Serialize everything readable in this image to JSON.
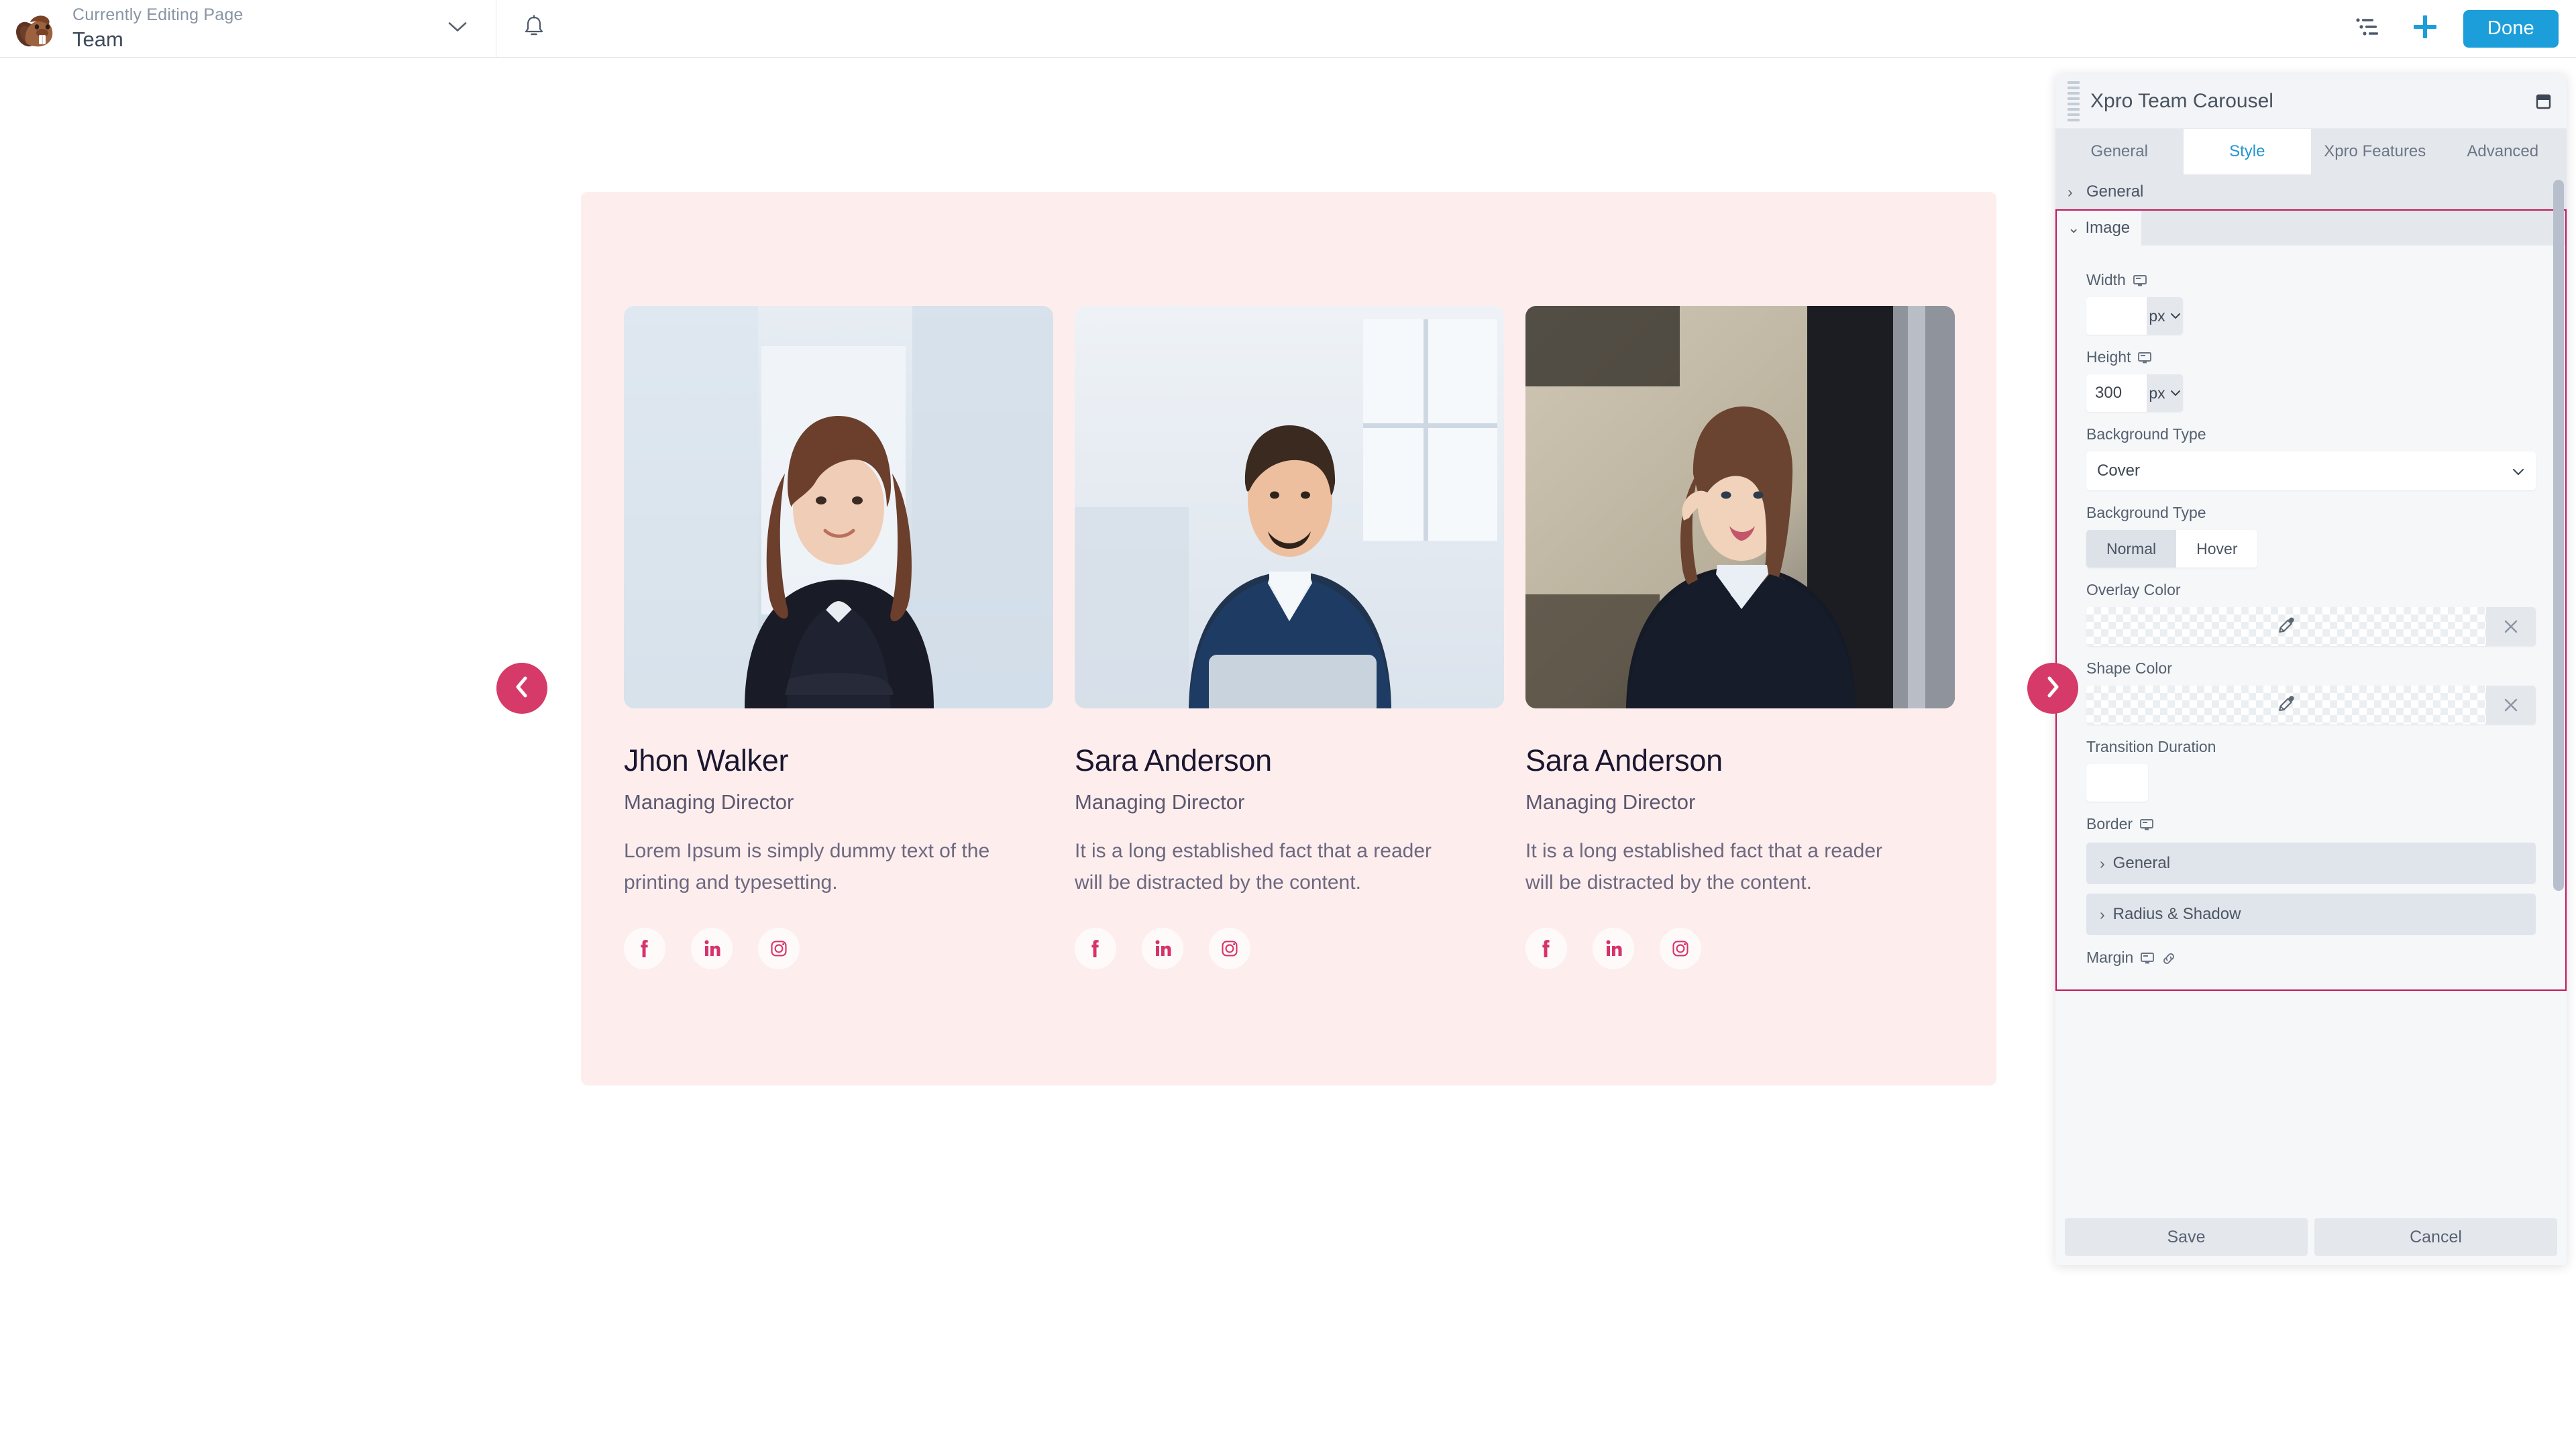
{
  "topbar": {
    "logo_alt": "beaver-builder-logo",
    "page_label": "Currently Editing Page",
    "page_title": "Team",
    "chevron": "⌄",
    "bell_icon": "notification-bell-icon",
    "outline_icon": "outline-panel-icon",
    "add_icon": "+",
    "done_label": "Done",
    "accent_blue": "#1b9ed9"
  },
  "canvas": {
    "module_bg": "#fdeeed",
    "accent_pink": "#d63a68",
    "prev_arrow": "‹",
    "next_arrow": "›",
    "members": [
      {
        "name": "Jhon Walker",
        "role": "Managing Director",
        "desc": "Lorem Ipsum is simply dummy text of the printing and typesetting.",
        "socials": [
          "facebook-icon",
          "linkedin-icon",
          "instagram-icon"
        ]
      },
      {
        "name": "Sara Anderson",
        "role": "Managing Director",
        "desc": "It is a long established fact that a reader will be distracted by the content.",
        "socials": [
          "facebook-icon",
          "linkedin-icon",
          "instagram-icon"
        ]
      },
      {
        "name": "Sara Anderson",
        "role": "Managing Director",
        "desc": "It is a long established fact that a reader will be distracted by the content.",
        "socials": [
          "facebook-icon",
          "linkedin-icon",
          "instagram-icon"
        ]
      }
    ]
  },
  "panel": {
    "title": "Xpro Team Carousel",
    "minimize_icon": "minimize-window-icon",
    "drag_handle_icon": "drag-handle-icon",
    "highlight_color": "#c2185b",
    "tabs": [
      {
        "label": "General",
        "active": false
      },
      {
        "label": "Style",
        "active": true
      },
      {
        "label": "Xpro Features",
        "active": false
      },
      {
        "label": "Advanced",
        "active": false
      }
    ],
    "sections": {
      "general_label": "General",
      "general_chevron": "›",
      "image_label": "Image",
      "image_chevron": "⌄"
    },
    "fields": {
      "width_label": "Width",
      "width_value": "",
      "width_unit": "px",
      "height_label": "Height",
      "height_value": "300",
      "height_unit": "px",
      "bg_type_label": "Background Type",
      "bg_type_value": "Cover",
      "bg_state_label": "Background Type",
      "state_normal": "Normal",
      "state_hover": "Hover",
      "state_selected": "Hover",
      "overlay_color_label": "Overlay Color",
      "overlay_color_value": "",
      "shape_color_label": "Shape Color",
      "shape_color_value": "",
      "transition_label": "Transition Duration",
      "transition_value": "",
      "border_label": "Border",
      "border_general_label": "General",
      "border_general_chevron": "›",
      "radius_shadow_label": "Radius & Shadow",
      "radius_shadow_chevron": "›",
      "margin_label": "Margin",
      "eyedropper_icon": "eyedropper-icon",
      "clear_icon": "×",
      "responsive_icon": "responsive-device-icon",
      "link_icon": "link-icon",
      "select_chevron": "⌄"
    },
    "footer": {
      "save_label": "Save",
      "cancel_label": "Cancel"
    }
  }
}
